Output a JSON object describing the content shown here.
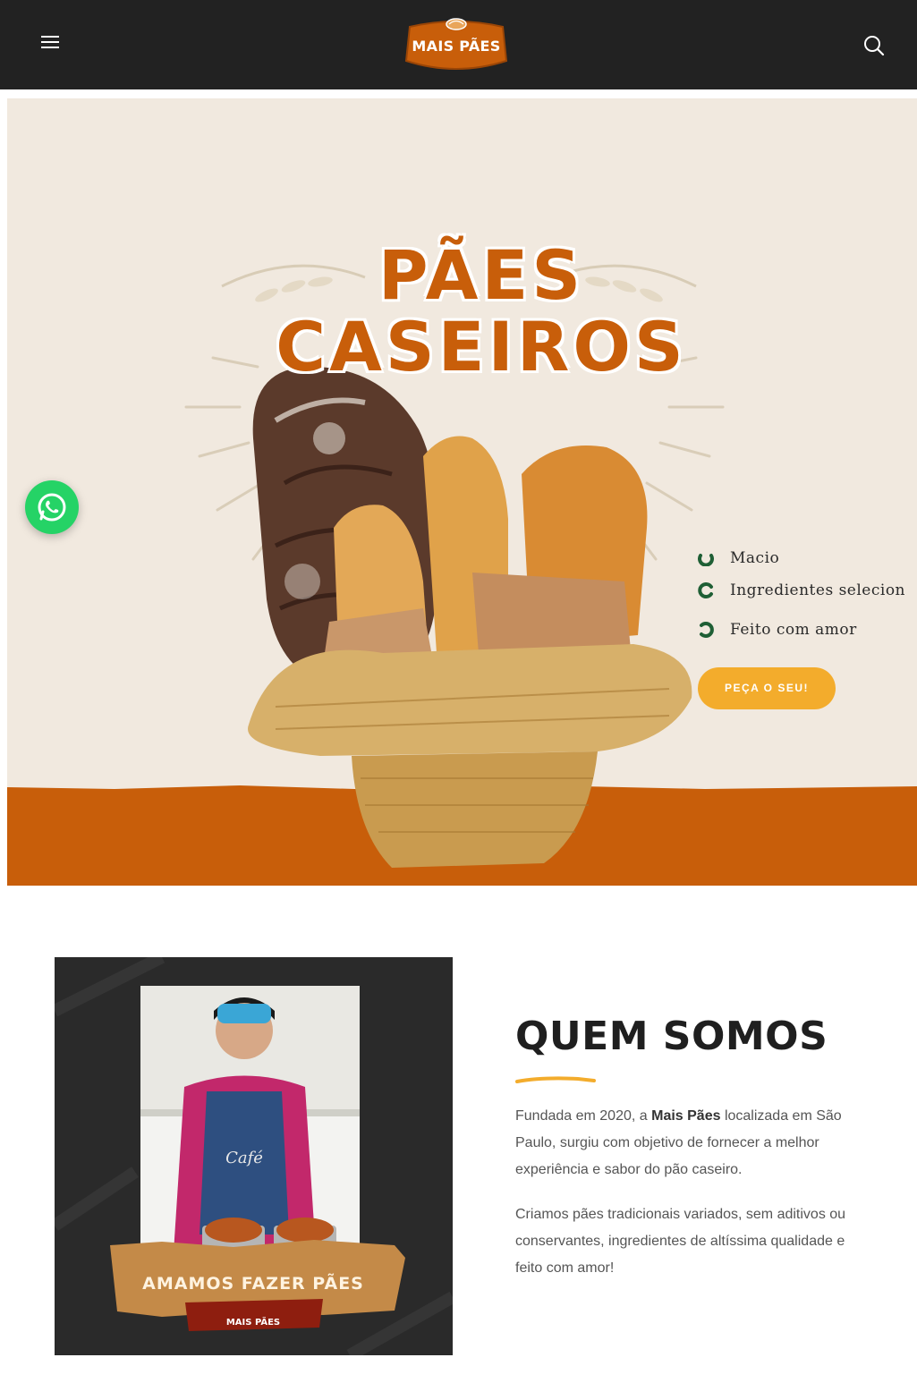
{
  "header": {
    "logo_text": "MAIS PÃES",
    "menu_icon": "hamburger-icon",
    "search_icon": "search-icon"
  },
  "hero": {
    "title_line1": "PÃES",
    "title_line2": "CASEIROS",
    "features": [
      {
        "label": "Macio",
        "icon": "check-circle-icon"
      },
      {
        "label": "Ingredientes selecion",
        "icon": "check-circle-icon"
      },
      {
        "label": "Feito com amor",
        "icon": "check-circle-icon"
      }
    ],
    "cta_label": "PEÇA O SEU!"
  },
  "whatsapp": {
    "icon": "whatsapp-icon"
  },
  "about": {
    "title": "QUEM SOMOS",
    "p1_before": "Fundada em 2020, a ",
    "p1_bold": "Mais Pães",
    "p1_after": " localizada em São Paulo, surgiu com objetivo de fornecer a melhor experiência e sabor do pão caseiro.",
    "p2": "Criamos pães tradicionais variados, sem aditivos ou conservantes, ingredientes de altíssima qualidade e feito com amor!",
    "photo_banner": "AMAMOS FAZER PÃES",
    "photo_logo": "MAIS PÃES",
    "apron_text": "Café"
  },
  "colors": {
    "topbar": "#222222",
    "brand_orange": "#c85e0a",
    "cta_yellow": "#f3ac2c",
    "check_green": "#1f5f35",
    "whatsapp_green": "#25d366"
  }
}
